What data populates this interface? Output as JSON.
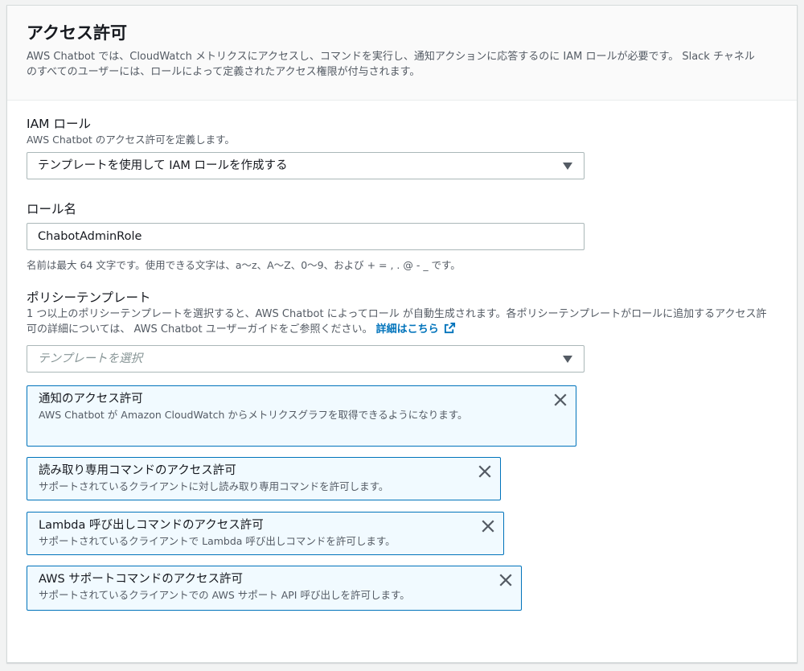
{
  "header": {
    "title": "アクセス許可",
    "description": "AWS Chatbot では、CloudWatch メトリクスにアクセスし、コマンドを実行し、通知アクションに応答するのに IAM ロールが必要です。 Slack チャネル のすべてのユーザーには、ロールによって定義されたアクセス権限が付与されます。"
  },
  "iam_role": {
    "label": "IAM ロール",
    "description": "AWS Chatbot のアクセス許可を定義します。",
    "selected": "テンプレートを使用して IAM ロールを作成する"
  },
  "role_name": {
    "label": "ロール名",
    "value": "ChabotAdminRole",
    "constraint": "名前は最大 64 文字です。使用できる文字は、a〜z、A〜Z、0〜9、および + = , . @ - _ です。"
  },
  "policy_templates": {
    "label": "ポリシーテンプレート",
    "description": "1 つ以上のポリシーテンプレートを選択すると、AWS Chatbot によってロール が自動生成されます。各ポリシーテンプレートがロールに追加するアクセス許可の詳細については、 AWS Chatbot ユーザーガイドをご参照ください。",
    "link_text": "詳細はこちら",
    "placeholder": "テンプレートを選択",
    "tokens": [
      {
        "title": "通知のアクセス許可",
        "description": "AWS Chatbot が Amazon CloudWatch からメトリクスグラフを取得できるようになります。"
      },
      {
        "title": "読み取り専用コマンドのアクセス許可",
        "description": "サポートされているクライアントに対し読み取り専用コマンドを許可します。"
      },
      {
        "title": "Lambda 呼び出しコマンドのアクセス許可",
        "description": "サポートされているクライアントで Lambda 呼び出しコマンドを許可します。"
      },
      {
        "title": "AWS サポートコマンドのアクセス許可",
        "description": "サポートされているクライアントでの AWS サポート API 呼び出しを許可します。"
      }
    ]
  },
  "icons": {
    "dropdown": "caret-down-icon",
    "external_link": "external-link-icon",
    "remove": "close-icon"
  },
  "colors": {
    "link": "#0073bb",
    "token_border": "#0073bb",
    "token_background": "#f1faff"
  }
}
